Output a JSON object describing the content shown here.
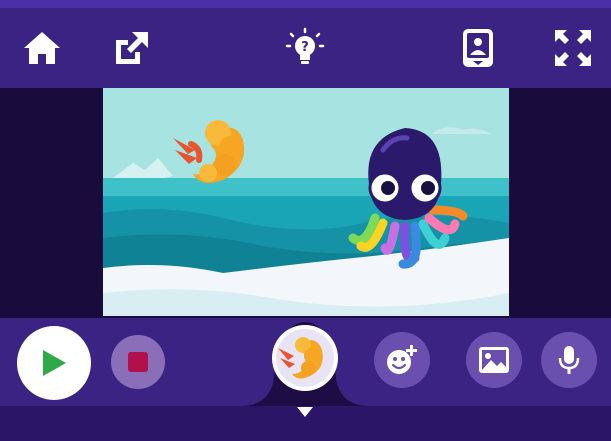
{
  "toolbar": {
    "icons": [
      "home-icon",
      "share-icon",
      "hint-bulb-icon",
      "device-view-icon",
      "fullscreen-icon"
    ]
  },
  "colors": {
    "toolbar": "#3b2384",
    "background": "#1e0d44",
    "play": "#2fa84a",
    "stop": "#b0104c",
    "sky": "#a7e3e0",
    "sea": "#1aa5b7",
    "ice": "#f3f7fb"
  },
  "stage": {
    "sprites": [
      "shrimp-sprite",
      "octopus-sprite"
    ]
  },
  "controls": {
    "icons": [
      "play-icon",
      "stop-icon",
      "add-sprite-icon",
      "backdrop-icon",
      "microphone-icon",
      "chevron-down-icon"
    ]
  }
}
